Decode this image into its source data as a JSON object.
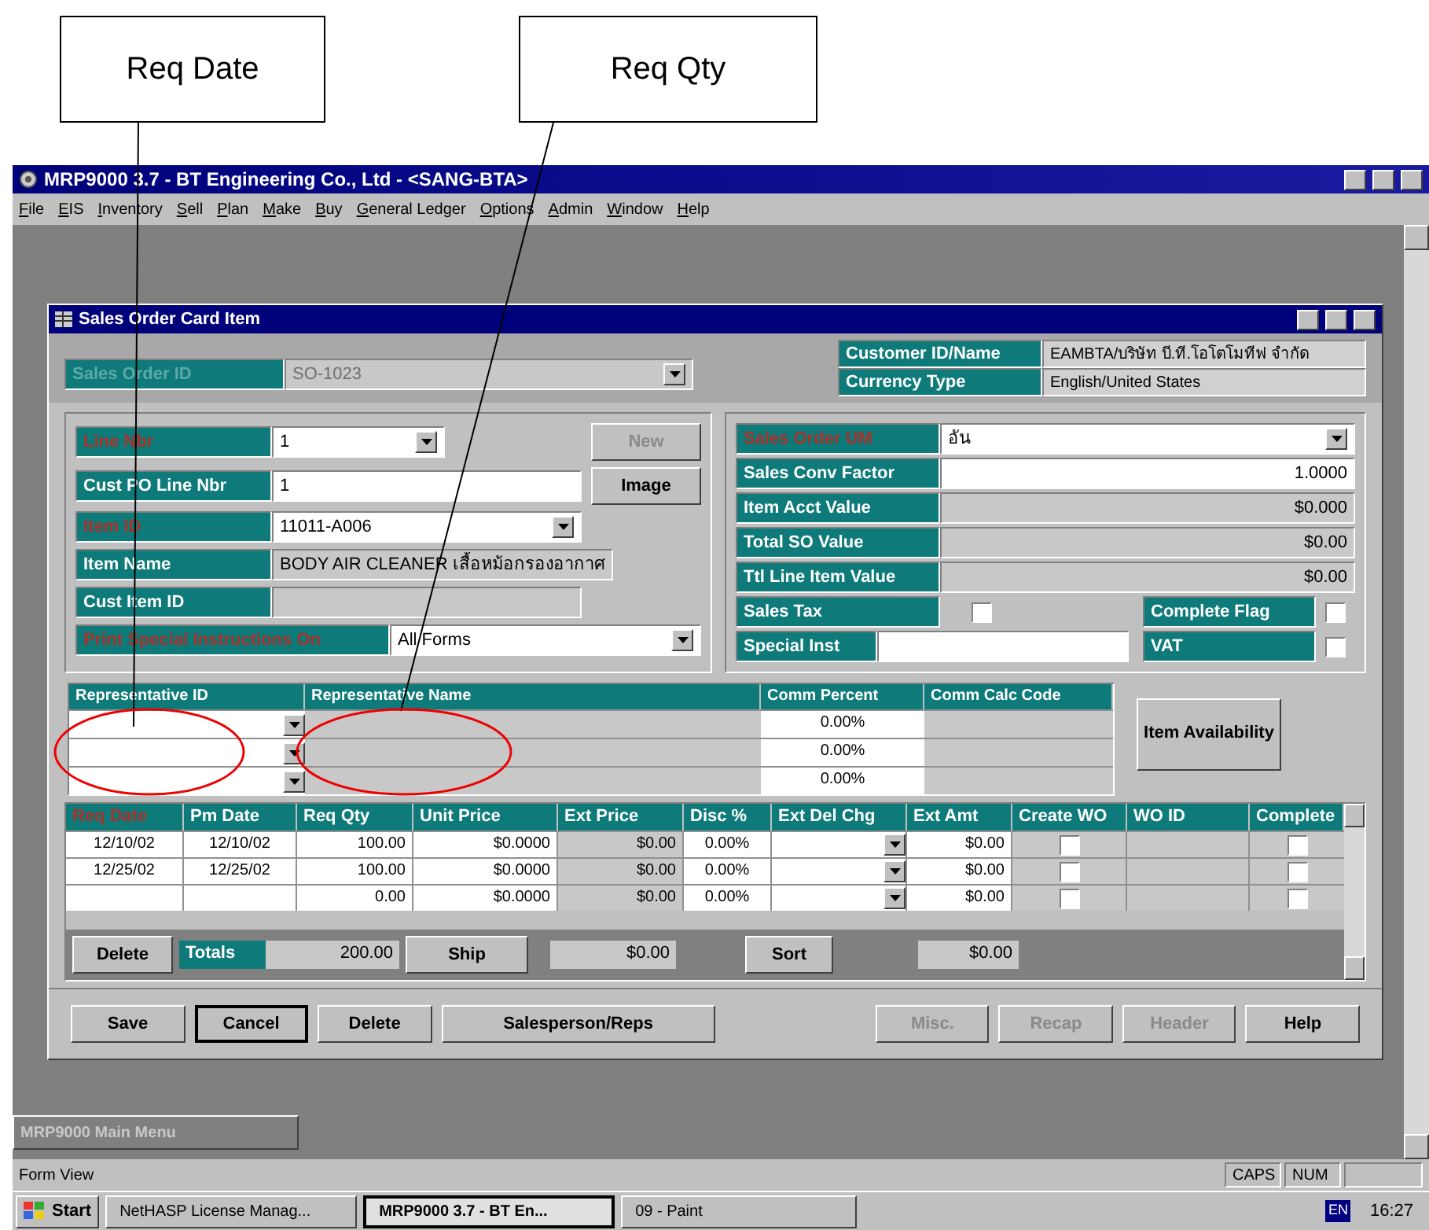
{
  "callouts": [
    {
      "label": "Req Date"
    },
    {
      "label": "Req Qty"
    }
  ],
  "app": {
    "title": "MRP9000 3.7 - BT Engineering Co., Ltd - <SANG-BTA>"
  },
  "menu": [
    "File",
    "EIS",
    "Inventory",
    "Sell",
    "Plan",
    "Make",
    "Buy",
    "General Ledger",
    "Options",
    "Admin",
    "Window",
    "Help"
  ],
  "child": {
    "title": "Sales Order Card Item"
  },
  "header": {
    "sales_order_id": {
      "label": "Sales Order ID",
      "value": "SO-1023",
      "disabled": true
    },
    "info": [
      {
        "label": "Customer ID/Name",
        "value": "EAMBTA/บริษัท บี.ที.โอโตโมทีฟ จำกัด"
      },
      {
        "label": "Currency Type",
        "value": "English/United States"
      }
    ]
  },
  "left_fields": [
    {
      "label": "Line Nbr",
      "kind": "combo",
      "value": "1",
      "required": true
    },
    {
      "label": "Cust PO Line Nbr",
      "kind": "text",
      "value": "1",
      "required": false
    },
    {
      "label": "Item ID",
      "kind": "combo",
      "value": "11011-A006",
      "required": true
    },
    {
      "label": "Item Name",
      "kind": "readonly",
      "value": "BODY AIR CLEANER เสื้อหม้อกรองอากาศ",
      "required": false
    },
    {
      "label": "Cust Item ID",
      "kind": "readonly",
      "required": false
    },
    {
      "label": "Print Special Instructions On",
      "kind": "combo",
      "value": "All Forms",
      "required": true
    }
  ],
  "side_buttons": [
    {
      "label": "New",
      "disabled": true
    },
    {
      "label": "Image",
      "disabled": false
    }
  ],
  "right_fields": [
    {
      "label": "Sales Order UM",
      "kind": "combo",
      "value": "อัน",
      "required": true
    },
    {
      "label": "Sales Conv Factor",
      "kind": "text",
      "value": "1.0000",
      "required": false
    },
    {
      "label": "Item Acct Value",
      "kind": "readonly",
      "value": "$0.000",
      "required": false
    },
    {
      "label": "Total SO Value",
      "kind": "readonly",
      "value": "$0.00",
      "required": false
    },
    {
      "label": "Ttl Line Item Value",
      "kind": "readonly",
      "value": "$0.00",
      "required": false
    }
  ],
  "sales_tax": {
    "label": "Sales Tax",
    "checked": false
  },
  "special_inst": {
    "label": "Special Inst"
  },
  "flags": [
    {
      "label": "Complete Flag",
      "checked": false
    },
    {
      "label": "VAT",
      "checked": false
    }
  ],
  "reps": {
    "columns": [
      "Representative ID",
      "Representative Name",
      "Comm Percent",
      "Comm Calc Code"
    ],
    "rows": [
      {
        "comm_percent": "0.00%"
      },
      {
        "comm_percent": "0.00%"
      },
      {
        "comm_percent": "0.00%"
      }
    ]
  },
  "item_availability": {
    "label": "Item Availability"
  },
  "lines": {
    "columns": [
      {
        "label": "Req Date",
        "required": true
      },
      {
        "label": "Pm Date",
        "required": false
      },
      {
        "label": "Req Qty",
        "required": false
      },
      {
        "label": "Unit Price",
        "required": false
      },
      {
        "label": "Ext Price",
        "required": false
      },
      {
        "label": "Disc %",
        "required": false
      },
      {
        "label": "Ext Del Chg",
        "required": false
      },
      {
        "label": "Ext Amt",
        "required": false
      },
      {
        "label": "Create WO",
        "required": false
      },
      {
        "label": "WO ID",
        "required": false
      },
      {
        "label": "Complete",
        "required": false
      }
    ],
    "rows": [
      {
        "req_date": "12/10/02",
        "pm_date": "12/10/02",
        "req_qty": "100.00",
        "unit_price": "$0.0000",
        "ext_price": "$0.00",
        "disc": "0.00%",
        "ext_amt": "$0.00",
        "create_wo": false,
        "complete": false
      },
      {
        "req_date": "12/25/02",
        "pm_date": "12/25/02",
        "req_qty": "100.00",
        "unit_price": "$0.0000",
        "ext_price": "$0.00",
        "disc": "0.00%",
        "ext_amt": "$0.00",
        "create_wo": false,
        "complete": false
      },
      {
        "req_date": "",
        "pm_date": "",
        "req_qty": "0.00",
        "unit_price": "$0.0000",
        "ext_price": "$0.00",
        "disc": "0.00%",
        "ext_amt": "$0.00",
        "create_wo": false,
        "complete": false
      }
    ]
  },
  "totals": {
    "delete": "Delete",
    "label": "Totals",
    "qty": "200.00",
    "ship": "Ship",
    "ext_price": "$0.00",
    "sort": "Sort",
    "ext_amt": "$0.00"
  },
  "buttons": [
    {
      "label": "Save",
      "disabled": false,
      "pressed": false
    },
    {
      "label": "Cancel",
      "disabled": false,
      "pressed": true
    },
    {
      "label": "Delete",
      "disabled": false,
      "pressed": false
    },
    {
      "label": "Salesperson/Reps",
      "disabled": false,
      "pressed": false
    },
    {
      "label": "Misc.",
      "disabled": true,
      "pressed": false
    },
    {
      "label": "Recap",
      "disabled": true,
      "pressed": false
    },
    {
      "label": "Header",
      "disabled": true,
      "pressed": false
    },
    {
      "label": "Help",
      "disabled": false,
      "pressed": false
    }
  ],
  "minimized": {
    "title": "MRP9000 Main Menu"
  },
  "status_bar": {
    "text": "Form View",
    "indicators": [
      "CAPS",
      "NUM"
    ]
  },
  "taskbar": {
    "start": "Start",
    "tasks": [
      {
        "label": "NetHASP License Manag...",
        "selected": false
      },
      {
        "label": "MRP9000 3.7 - BT En...",
        "selected": true
      },
      {
        "label": "09 - Paint",
        "selected": false
      }
    ],
    "lang": "EN",
    "clock": "16:27"
  }
}
